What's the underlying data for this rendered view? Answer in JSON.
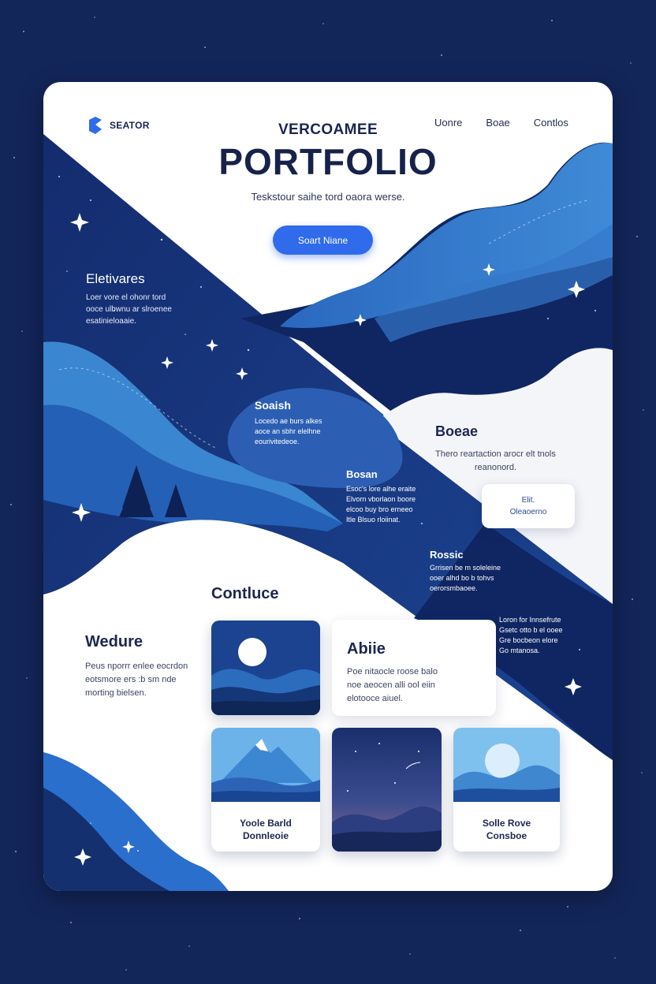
{
  "brand": {
    "name": "SEATOR"
  },
  "nav": {
    "items": [
      "Uonre",
      "Boae",
      "Contlos"
    ]
  },
  "hero": {
    "eyebrow": "VERCOAMEE",
    "title": "PORTFOLIO",
    "subtitle": "Teskstour saihe tord oaora werse.",
    "cta": "Soart Niane"
  },
  "sections": {
    "eletivares": {
      "title": "Eletivares",
      "lines": [
        "Loer vore el ohonr tord",
        "ooce ulbwnu ar slroenee",
        "esatinieloaaie."
      ]
    },
    "soaish": {
      "title": "Soaish",
      "lines": [
        "Locedo ae burs alkes",
        "aoce an sbhr elelhne",
        "eourivitedeoe."
      ]
    },
    "bosan": {
      "title": "Bosan",
      "lines": [
        "Esoc's lore alhe eraite",
        "Elvorn vborlaon boore",
        "elcoo buy bro erneeo",
        "Itle Blsuo rloiinat."
      ]
    },
    "boeae": {
      "title": "Boeae",
      "lines": [
        "Thero reartaction arocr elt tnols",
        "reanonord."
      ]
    },
    "pill": {
      "lines": [
        "Elit.",
        "Oleaoerno"
      ]
    },
    "rossic": {
      "title": "Rossic",
      "lines": [
        "Grrisen be m soleleine",
        "ooer alhd bo b tohvs",
        "oerorsmbaoee."
      ]
    },
    "side_note": {
      "lines": [
        "Loron for Innsefrute",
        "Gsetc otto b el ooee",
        "Gre bocbeon elore",
        "Go mtanosa."
      ]
    },
    "contluce": {
      "title": "Contluce"
    },
    "wedure": {
      "title": "Wedure",
      "lines": [
        "Peus nporrr enlee eocrdon",
        "eotsmore ers :b sm nde",
        "morting bielsen."
      ]
    },
    "abiie": {
      "title": "Abiie",
      "lines": [
        "Poe nitaocle roose balo",
        "noe aeocen alli ool eiin",
        "elotooce aiuel."
      ]
    }
  },
  "tiles": [
    {
      "lines": [
        "Yoole Barld",
        "Donnleoie"
      ]
    },
    {
      "lines": []
    },
    {
      "lines": [
        "Solle Rove",
        "Consboe"
      ]
    }
  ],
  "colors": {
    "accent": "#2f6bea",
    "navy": "#13265a",
    "ink": "#16224a"
  },
  "icons": [
    "logo-mark-icon",
    "sparkle-star-icon",
    "pine-tree-icon",
    "moon-icon",
    "mountain-icon"
  ]
}
